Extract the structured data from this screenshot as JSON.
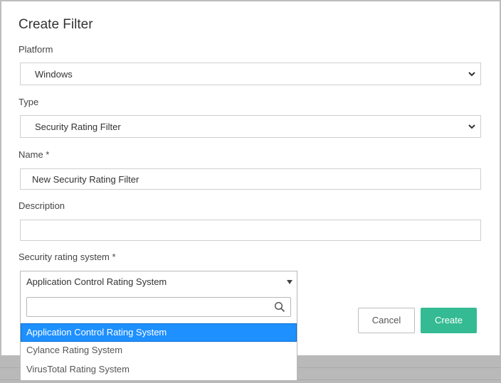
{
  "dialog": {
    "title": "Create Filter",
    "platform": {
      "label": "Platform",
      "value": "Windows"
    },
    "type": {
      "label": "Type",
      "value": "Security Rating Filter"
    },
    "name": {
      "label": "Name *",
      "value": "New Security Rating Filter"
    },
    "description": {
      "label": "Description",
      "value": ""
    },
    "rating_system": {
      "label": "Security rating system *",
      "value": "Application Control Rating System",
      "search_value": "",
      "options": [
        "Application Control Rating System",
        "Cylance Rating System",
        "VirusTotal Rating System"
      ]
    },
    "buttons": {
      "cancel": "Cancel",
      "create": "Create"
    }
  },
  "icons": {
    "select_arrow": "chevron-down-icon",
    "dropdown_arrow": "caret-down-icon",
    "search": "search-icon"
  },
  "colors": {
    "primary": "#34bb93",
    "highlight": "#1e90ff"
  }
}
